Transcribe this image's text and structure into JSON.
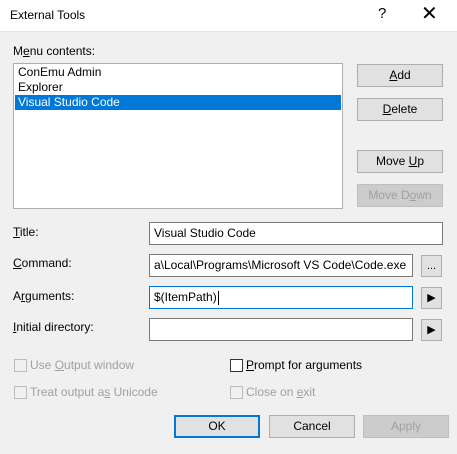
{
  "window": {
    "title": "External Tools",
    "help_glyph": "?",
    "close_glyph": "✕"
  },
  "menu_contents": {
    "label_pre": "M",
    "label_acc": "e",
    "label_post": "nu contents:",
    "items": [
      {
        "label": "ConEmu Admin",
        "selected": false
      },
      {
        "label": "Explorer",
        "selected": false
      },
      {
        "label": "Visual Studio Code",
        "selected": true
      }
    ]
  },
  "side_buttons": {
    "add": {
      "acc": "A",
      "rest": "dd"
    },
    "delete": {
      "acc": "D",
      "rest": "elete"
    },
    "move_up": {
      "pre": "Move ",
      "acc": "U",
      "rest": "p"
    },
    "move_down": {
      "pre": "Move D",
      "acc": "o",
      "rest": "wn"
    }
  },
  "fields": {
    "title": {
      "acc": "T",
      "rest": "itle:",
      "value": "Visual Studio Code"
    },
    "command": {
      "acc": "C",
      "rest": "ommand:",
      "value": "a\\Local\\Programs\\Microsoft VS Code\\Code.exe",
      "browse_label": "..."
    },
    "arguments": {
      "pre": "A",
      "acc": "r",
      "rest": "guments:",
      "value": "$(ItemPath)",
      "arrow": "▶"
    },
    "initial_directory": {
      "pre": "",
      "acc": "I",
      "rest": "nitial directory:",
      "value": "",
      "arrow": "▶"
    }
  },
  "checkboxes": {
    "use_output": {
      "pre": "Use ",
      "acc": "O",
      "rest": "utput window",
      "checked": false,
      "disabled": true
    },
    "prompt_args": {
      "pre": "",
      "acc": "P",
      "rest": "rompt for arguments",
      "checked": false,
      "disabled": false
    },
    "unicode": {
      "pre": "Treat output a",
      "acc": "s",
      "rest": " Unicode",
      "checked": false,
      "disabled": true
    },
    "close_exit": {
      "pre": "Close on ",
      "acc": "e",
      "rest": "xit",
      "checked": false,
      "disabled": true
    }
  },
  "footer": {
    "ok": "OK",
    "cancel": "Cancel",
    "apply": "Apply"
  }
}
